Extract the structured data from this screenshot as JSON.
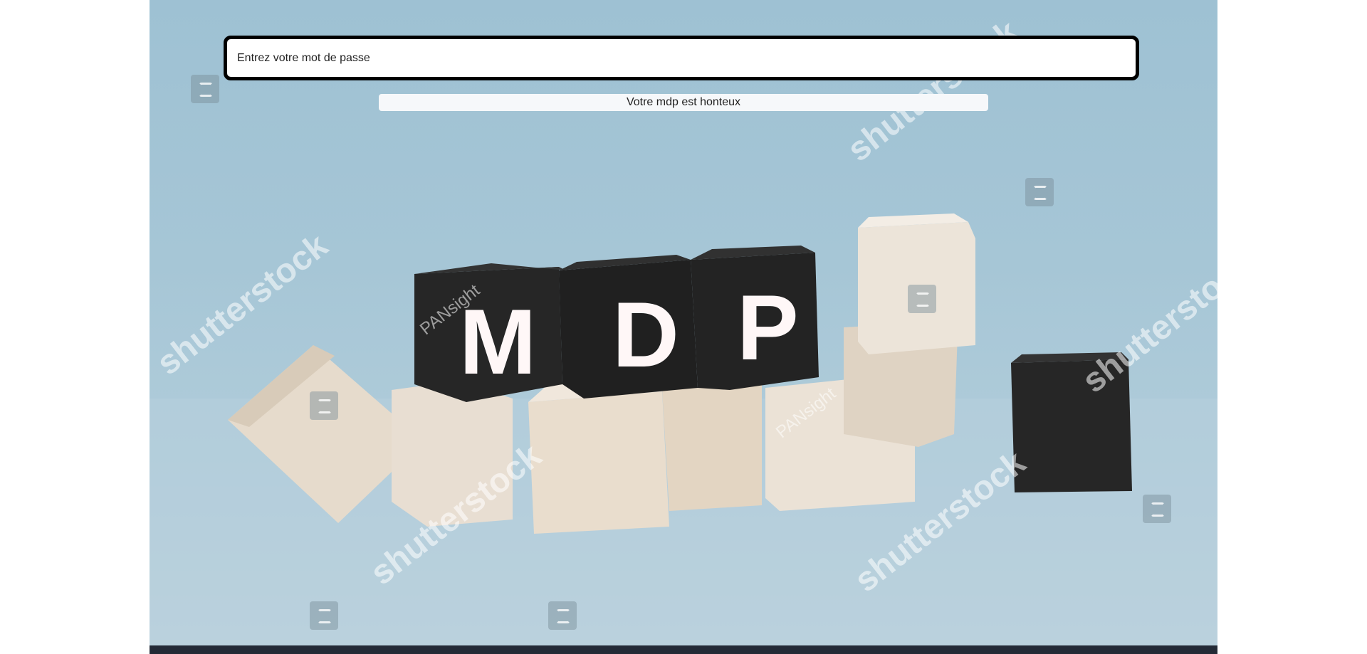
{
  "password_field": {
    "placeholder": "Entrez votre mot de passe",
    "value": ""
  },
  "feedback": {
    "message": "Votre mdp est honteux"
  },
  "hero_image": {
    "letters": [
      "M",
      "D",
      "P"
    ],
    "watermarks": [
      "shutterstock",
      "PANsight"
    ]
  },
  "colors": {
    "background": "#a6c6d6",
    "input_border": "#000000",
    "bottom_bar": "#232a36",
    "block_dark": "#262626",
    "block_light": "#e2d8cb"
  }
}
